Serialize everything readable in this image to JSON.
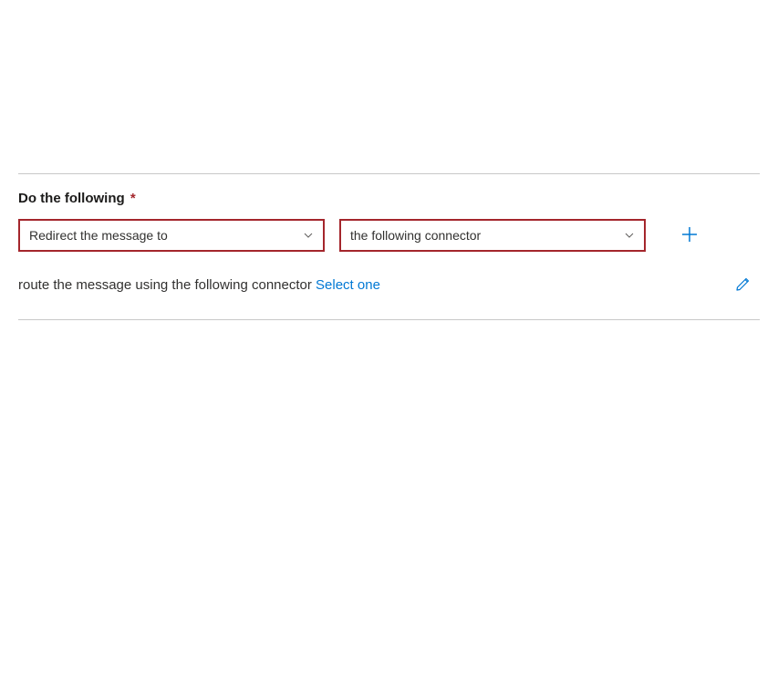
{
  "section": {
    "label": "Do the following",
    "required_marker": "*"
  },
  "action_select": {
    "value": "Redirect the message to"
  },
  "target_select": {
    "value": "the following connector"
  },
  "helper": {
    "prefix": "route the message using the following connector ",
    "link": "Select one"
  },
  "colors": {
    "accent": "#0078d4",
    "error_border": "#a4262c"
  }
}
